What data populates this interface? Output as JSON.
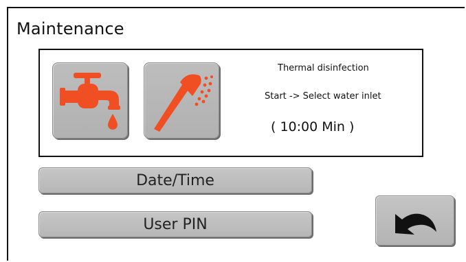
{
  "header": {
    "title": "Maintenance"
  },
  "disinfection": {
    "title": "Thermal disinfection",
    "instruction": "Start -> Select water inlet",
    "duration": "( 10:00 Min )",
    "buttons": [
      {
        "icon": "faucet-icon"
      },
      {
        "icon": "shower-head-icon"
      }
    ],
    "icon_color": "#f04e23"
  },
  "menu": {
    "date_time_label": "Date/Time",
    "user_pin_label": "User PIN"
  },
  "navigation": {
    "back_icon": "back-arrow-icon"
  }
}
